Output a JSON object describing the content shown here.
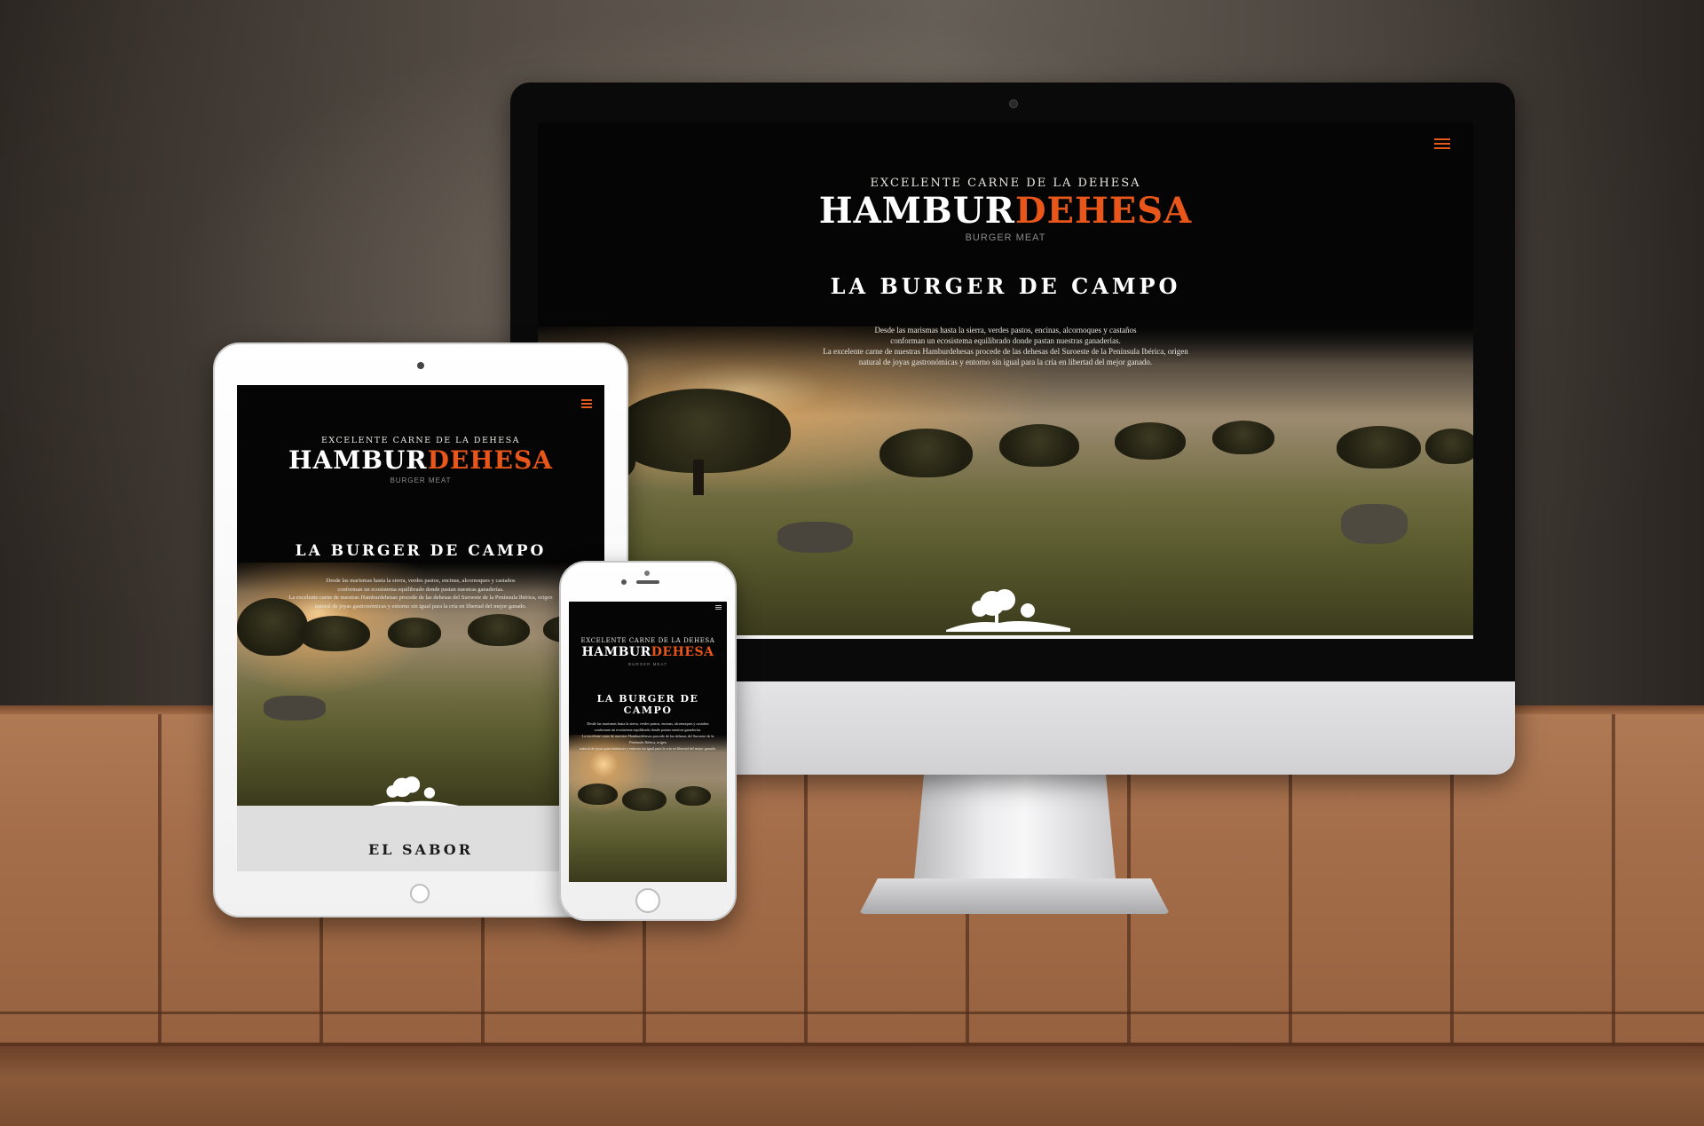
{
  "brand": {
    "tagline": "EXCELENTE CARNE DE LA DEHESA",
    "logo_white": "HAMBUR",
    "logo_orange": "DEHESA",
    "sublogo": "BURGER MEAT",
    "accent_color": "#e8561a"
  },
  "hero": {
    "headline": "LA BURGER DE CAMPO",
    "lines": [
      "Desde las marismas hasta la sierra, verdes pastos, encinas, alcornoques y castaños",
      "conforman un ecosistema equilibrado donde pastan nuestras ganaderías.",
      "La excelente carne de nuestras Hamburdehesas procede de las dehesas del Suroeste de la Península Ibérica, origen",
      "natural de joyas gastronómicas y entorno sin igual para la cría en libertad del mejor ganado."
    ]
  },
  "next_section": {
    "title": "EL SABOR"
  },
  "icons": {
    "menu": "hamburger-menu-icon"
  }
}
